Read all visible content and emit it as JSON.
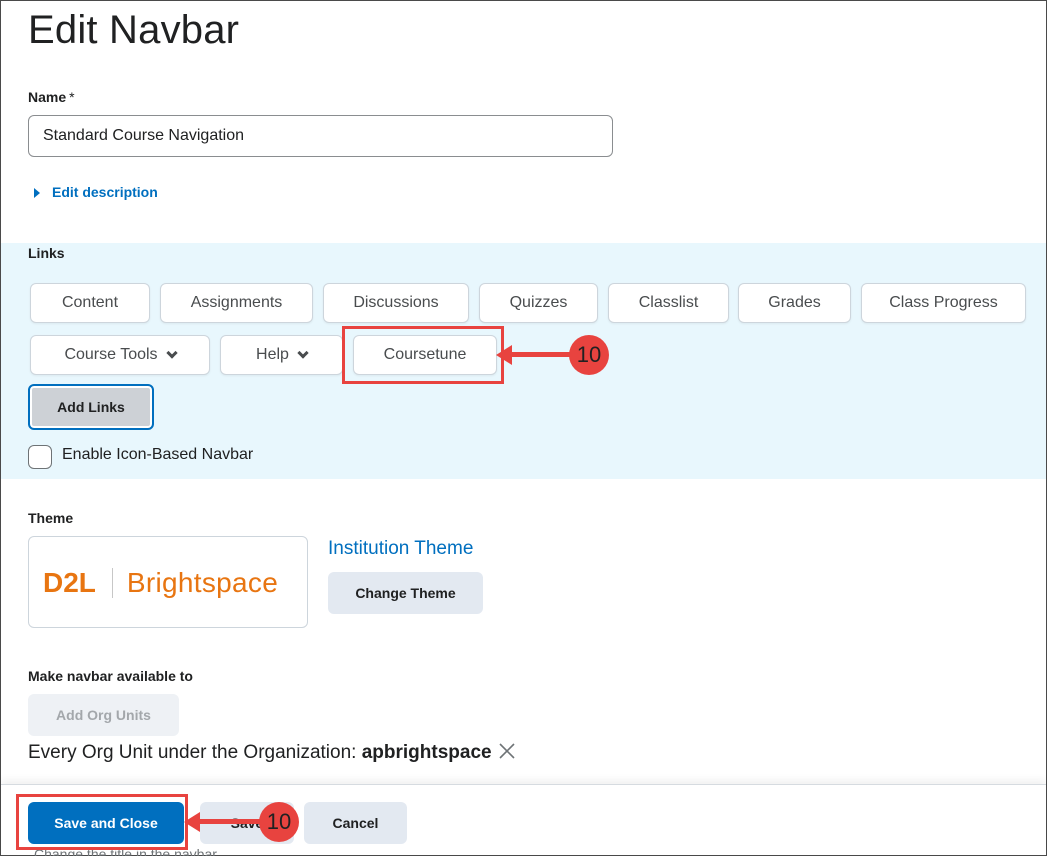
{
  "page": {
    "title": "Edit Navbar"
  },
  "name_field": {
    "label": "Name",
    "required_mark": "*",
    "value": "Standard Course Navigation"
  },
  "edit_description": {
    "label": "Edit description"
  },
  "links": {
    "label": "Links",
    "row1": [
      "Content",
      "Assignments",
      "Discussions",
      "Quizzes",
      "Classlist",
      "Grades",
      "Class Progress"
    ],
    "row2": [
      {
        "label": "Course Tools",
        "dropdown": true
      },
      {
        "label": "Help",
        "dropdown": true
      },
      {
        "label": "Coursetune",
        "dropdown": false
      }
    ],
    "add_button": "Add Links",
    "icon_navbar_checkbox": {
      "label": "Enable Icon-Based Navbar",
      "checked": false
    }
  },
  "theme": {
    "label": "Theme",
    "logo_mark": "D2L",
    "logo_text": "Brightspace",
    "current": "Institution Theme",
    "change_button": "Change Theme"
  },
  "availability": {
    "label": "Make navbar available to",
    "add_button": "Add Org Units",
    "org_text_prefix": "Every Org Unit under the Organization:",
    "org_name": "apbrightspace"
  },
  "footer": {
    "save_close": "Save and Close",
    "save": "Save",
    "cancel": "Cancel",
    "below_text": "Change the title in the navbar"
  },
  "annotations": {
    "callout_top": "10",
    "callout_bottom": "10"
  },
  "colors": {
    "accent": "#006fbf",
    "annotation": "#e8433f",
    "panel": "#e8f7fd",
    "logo": "#e87511"
  }
}
